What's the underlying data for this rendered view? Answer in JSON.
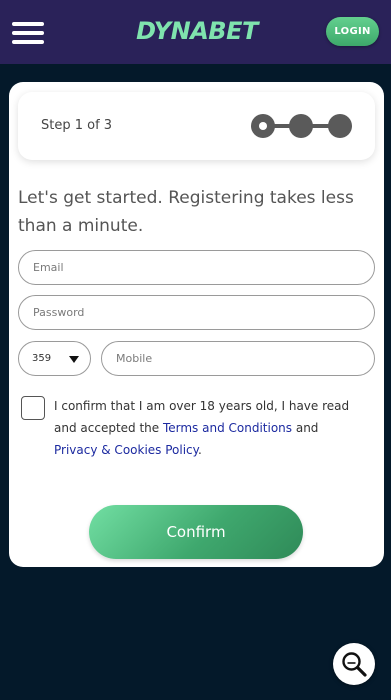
{
  "header": {
    "logo_text": "DYNABET",
    "login_label": "LOGIN",
    "menu_icon": "hamburger-menu-icon"
  },
  "step": {
    "label": "Step 1 of 3",
    "current": 1,
    "total": 3
  },
  "form": {
    "intro": "Let's get started. Registering takes less than a minute.",
    "email_placeholder": "Email",
    "password_placeholder": "Password",
    "country_code": "359",
    "mobile_placeholder": "Mobile",
    "consent_text_1": "I confirm that I am over 18 years old, I have read and accepted the ",
    "terms_link": "Terms and Conditions",
    "consent_text_2": " and ",
    "privacy_link": "Privacy & Cookies Policy",
    "consent_text_3": ".",
    "confirm_label": "Confirm"
  },
  "fab": {
    "icon": "search-zoom-icon"
  },
  "colors": {
    "header_bg": "#2a2259",
    "page_bg": "#04192a",
    "accent_green": "#4cbf80",
    "link_blue": "#1c2aa0"
  }
}
